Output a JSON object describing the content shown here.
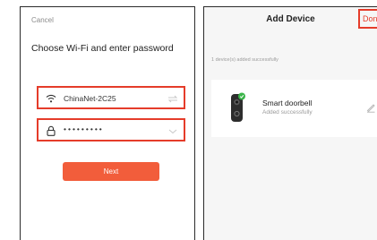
{
  "wifi_screen": {
    "cancel_label": "Cancel",
    "heading": "Choose Wi-Fi and enter password",
    "ssid_value": "ChinaNet-2C25",
    "password_mask": "•••••••••",
    "next_label": "Next"
  },
  "add_device_screen": {
    "title": "Add Device",
    "done_label": "Done",
    "status_text": "1 device(s) added successfully",
    "devices": [
      {
        "name": "Smart doorbell",
        "status": "Added successfully"
      }
    ]
  },
  "colors": {
    "highlight": "#e53c2a",
    "button": "#f25d3b",
    "success": "#3bb54a"
  }
}
